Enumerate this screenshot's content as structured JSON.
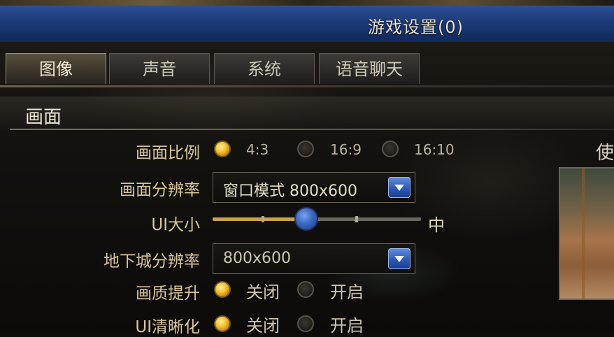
{
  "window": {
    "title": "游戏设置(0)"
  },
  "tabs": [
    {
      "label": "图像",
      "active": true
    },
    {
      "label": "声音",
      "active": false
    },
    {
      "label": "系统",
      "active": false
    },
    {
      "label": "语音聊天",
      "active": false
    }
  ],
  "section": {
    "title": "画面"
  },
  "aspect_ratio": {
    "label": "画面比例",
    "options": [
      "4:3",
      "16:9",
      "16:10"
    ],
    "selected": "4:3"
  },
  "resolution": {
    "label": "画面分辨率",
    "value": "窗口模式 800x600"
  },
  "ui_size": {
    "label": "UI大小",
    "value_label": "中",
    "level": 0.44
  },
  "dungeon_resolution": {
    "label": "地下城分辨率",
    "value": "800x600"
  },
  "quality_boost": {
    "label": "画质提升",
    "options": [
      "关闭",
      "开启"
    ],
    "selected": "关闭"
  },
  "ui_sharpen": {
    "label": "UI清晰化",
    "options": [
      "关闭",
      "开启"
    ],
    "selected": "关闭"
  },
  "preview": {
    "label": "使"
  },
  "colors": {
    "title_bar": "#1d3a78",
    "radio_selected": "#f7c330",
    "slider_knob": "#3b68c4",
    "label_text": "#d8c79c"
  }
}
